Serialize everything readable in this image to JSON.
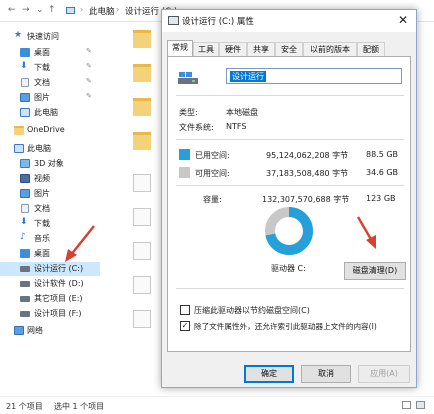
{
  "address": {
    "crumbs": [
      "此电脑",
      "设计运行 (C:)"
    ]
  },
  "sidebar": {
    "items": [
      {
        "label": "快速访问",
        "icon": "star-icon",
        "pinned": false
      },
      {
        "label": "桌面",
        "icon": "desktop-icon",
        "pinned": true
      },
      {
        "label": "下载",
        "icon": "download-icon",
        "pinned": true
      },
      {
        "label": "文档",
        "icon": "documents-icon",
        "pinned": true
      },
      {
        "label": "图片",
        "icon": "pictures-icon",
        "pinned": true
      },
      {
        "label": "此电脑",
        "icon": "computer-icon",
        "pinned": false
      },
      {
        "label": "OneDrive",
        "icon": "onedrive-icon",
        "pinned": false
      },
      {
        "label": "此电脑",
        "icon": "computer-icon",
        "pinned": false
      },
      {
        "label": "3D 对象",
        "icon": "3d-objects-icon",
        "pinned": false
      },
      {
        "label": "视频",
        "icon": "videos-icon",
        "pinned": false
      },
      {
        "label": "图片",
        "icon": "pictures-icon",
        "pinned": false
      },
      {
        "label": "文档",
        "icon": "documents-icon",
        "pinned": false
      },
      {
        "label": "下载",
        "icon": "download-icon",
        "pinned": false
      },
      {
        "label": "音乐",
        "icon": "music-icon",
        "pinned": false
      },
      {
        "label": "桌面",
        "icon": "desktop-icon",
        "pinned": false
      },
      {
        "label": "设计运行 (C:)",
        "icon": "drive-icon",
        "pinned": false,
        "selected": true
      },
      {
        "label": "设计软件 (D:)",
        "icon": "drive-icon",
        "pinned": false
      },
      {
        "label": "其它项目 (E:)",
        "icon": "drive-icon",
        "pinned": false
      },
      {
        "label": "设计项目 (F:)",
        "icon": "drive-icon",
        "pinned": false
      },
      {
        "label": "网络",
        "icon": "network-icon",
        "pinned": false
      }
    ]
  },
  "status": {
    "item_count": "21 个项目",
    "selected_count": "选中 1 个项目"
  },
  "dialog": {
    "title": "设计运行 (C:) 属性",
    "tabs": [
      "常规",
      "工具",
      "硬件",
      "共享",
      "安全",
      "以前的版本",
      "配额"
    ],
    "drive_name": "设计运行",
    "type_label": "类型:",
    "type_value": "本地磁盘",
    "fs_label": "文件系统:",
    "fs_value": "NTFS",
    "used_label": "已用空间:",
    "used_bytes": "95,124,062,208 字节",
    "used_size": "88.5 GB",
    "free_label": "可用空间:",
    "free_bytes": "37,183,508,480 字节",
    "free_size": "34.6 GB",
    "capacity_label": "容量:",
    "capacity_bytes": "132,307,570,688 字节",
    "capacity_size": "123 GB",
    "drive_caption": "驱动器 C:",
    "cleanup_button": "磁盘清理(D)",
    "compress_option": "压缩此驱动器以节约磁盘空间(C)",
    "index_option": "除了文件属性外，还允许索引此驱动器上文件的内容(I)",
    "ok": "确定",
    "cancel": "取消",
    "apply": "应用(A)",
    "colors": {
      "used": "#26a0da",
      "free": "#c8c8c8"
    },
    "usage": {
      "used_gb": 88.5,
      "free_gb": 34.6
    }
  }
}
